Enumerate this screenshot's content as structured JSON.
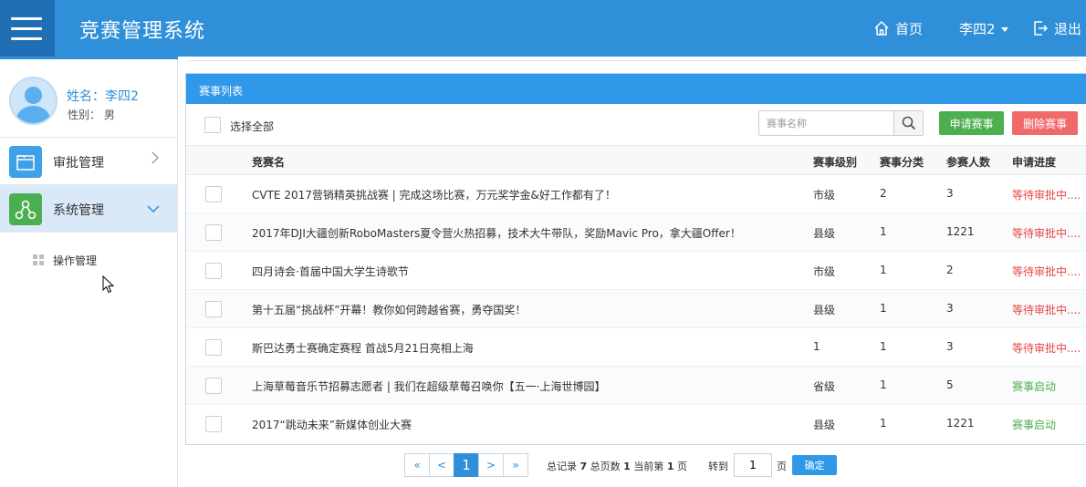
{
  "header": {
    "app_title": "竞赛管理系统",
    "home_label": "首页",
    "user_label": "李四2",
    "logout_label": "退出",
    "color": "#2f8fd8"
  },
  "sidebar": {
    "profile": {
      "name": "姓名：李四2",
      "gender": "性别： 男"
    },
    "items": [
      {
        "label": "审批管理",
        "icon": "folder-icon",
        "expanded": false
      },
      {
        "label": "系统管理",
        "icon": "network-icon",
        "expanded": true
      }
    ],
    "sub_items": [
      {
        "label": "操作管理",
        "icon": "grid-icon"
      }
    ]
  },
  "panel": {
    "title": "赛事列表",
    "select_all": "选择全部",
    "search_placeholder": "赛事名称",
    "apply_button": "申请赛事",
    "delete_button": "删除赛事"
  },
  "table": {
    "columns": [
      "竞赛名",
      "赛事级别",
      "赛事分类",
      "参赛人数",
      "申请进度"
    ],
    "rows": [
      {
        "title": "CVTE 2017营销精英挑战赛 | 完成这场比赛，万元奖学金&好工作都有了！",
        "level": "市级",
        "category": "2",
        "count": "3",
        "status": "等待审批中....",
        "status_type": "wait"
      },
      {
        "title": "2017年DJI大疆创新RoboMasters夏令营火热招募，技术大牛带队，奖励Mavic Pro，拿大疆Offer！",
        "level": "县级",
        "category": "1",
        "count": "1221",
        "status": "等待审批中....",
        "status_type": "wait"
      },
      {
        "title": "四月诗会·首届中国大学生诗歌节",
        "level": "市级",
        "category": "1",
        "count": "2",
        "status": "等待审批中....",
        "status_type": "wait"
      },
      {
        "title": "第十五届“挑战杯”开幕！教你如何跨越省赛，勇夺国奖！",
        "level": "县级",
        "category": "1",
        "count": "3",
        "status": "等待审批中....",
        "status_type": "wait"
      },
      {
        "title": "斯巴达勇士赛确定赛程 首战5月21日亮相上海",
        "level": "1",
        "category": "1",
        "count": "3",
        "status": "等待审批中....",
        "status_type": "wait"
      },
      {
        "title": "上海草莓音乐节招募志愿者 | 我们在超级草莓召唤你【五一·上海世博园】",
        "level": "省级",
        "category": "1",
        "count": "5",
        "status": "赛事启动",
        "status_type": "start"
      },
      {
        "title": "2017“跳动未来”新媒体创业大赛",
        "level": "县级",
        "category": "1",
        "count": "1221",
        "status": "赛事启动",
        "status_type": "start"
      }
    ]
  },
  "pagination": {
    "first": "«",
    "prev": "<",
    "current": "1",
    "next": ">",
    "last": "»",
    "total_label": "总记录",
    "total": "7",
    "pages_label": "总页数",
    "pages": "1",
    "current_label": "当前第",
    "current_page": "1",
    "page_unit": "页",
    "goto_label": "转到",
    "goto_value": "1",
    "goto_unit": "页",
    "confirm": "确定"
  }
}
